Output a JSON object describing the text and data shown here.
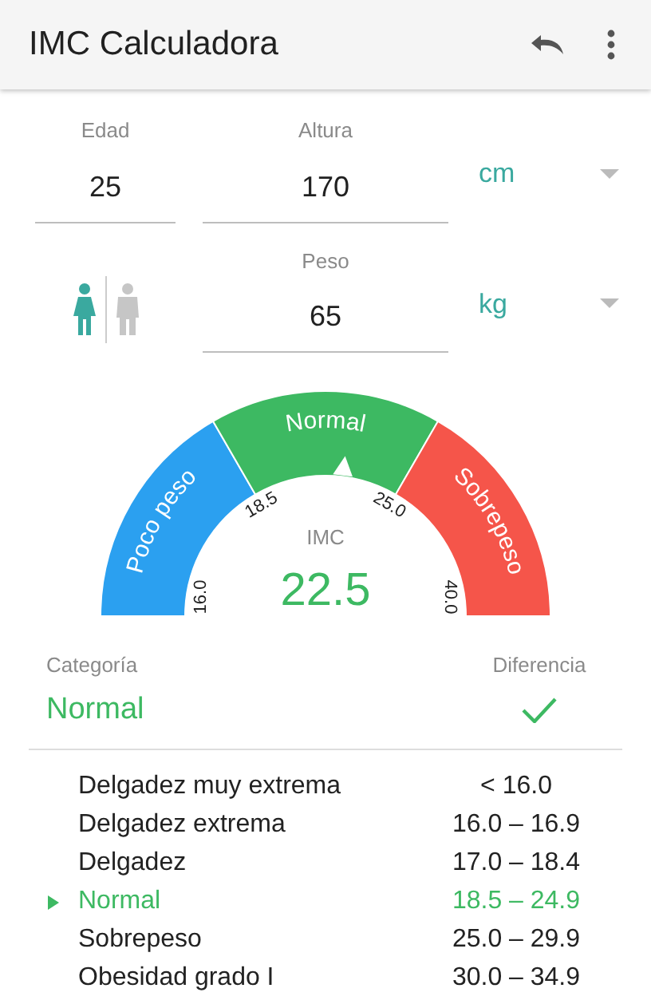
{
  "app_bar": {
    "title": "IMC Calculadora"
  },
  "age": {
    "label": "Edad",
    "value": "25"
  },
  "height": {
    "label": "Altura",
    "value": "170",
    "unit": "cm"
  },
  "weight": {
    "label": "Peso",
    "value": "65",
    "unit": "kg"
  },
  "genders": [
    {
      "kind": "female",
      "selected": true
    },
    {
      "kind": "male",
      "selected": false
    }
  ],
  "gauge": {
    "segments": [
      {
        "label": "Poco peso",
        "color": "#2ba0f0"
      },
      {
        "label": "Normal",
        "color": "#3db962"
      },
      {
        "label": "Sobrepeso",
        "color": "#f5554a"
      }
    ],
    "ticks": [
      "16.0",
      "18.5",
      "25.0",
      "40.0"
    ],
    "label": "IMC",
    "value": "22.5"
  },
  "result": {
    "category_header": "Categoría",
    "difference_header": "Diferencia",
    "category": "Normal",
    "difference_ok": true
  },
  "ranges": [
    {
      "name": "Delgadez muy extrema",
      "range": "< 16.0",
      "selected": false
    },
    {
      "name": "Delgadez extrema",
      "range": "16.0 – 16.9",
      "selected": false
    },
    {
      "name": "Delgadez",
      "range": "17.0 – 18.4",
      "selected": false
    },
    {
      "name": "Normal",
      "range": "18.5 – 24.9",
      "selected": true
    },
    {
      "name": "Sobrepeso",
      "range": "25.0 – 29.9",
      "selected": false
    },
    {
      "name": "Obesidad grado I",
      "range": "30.0 – 34.9",
      "selected": false
    }
  ]
}
